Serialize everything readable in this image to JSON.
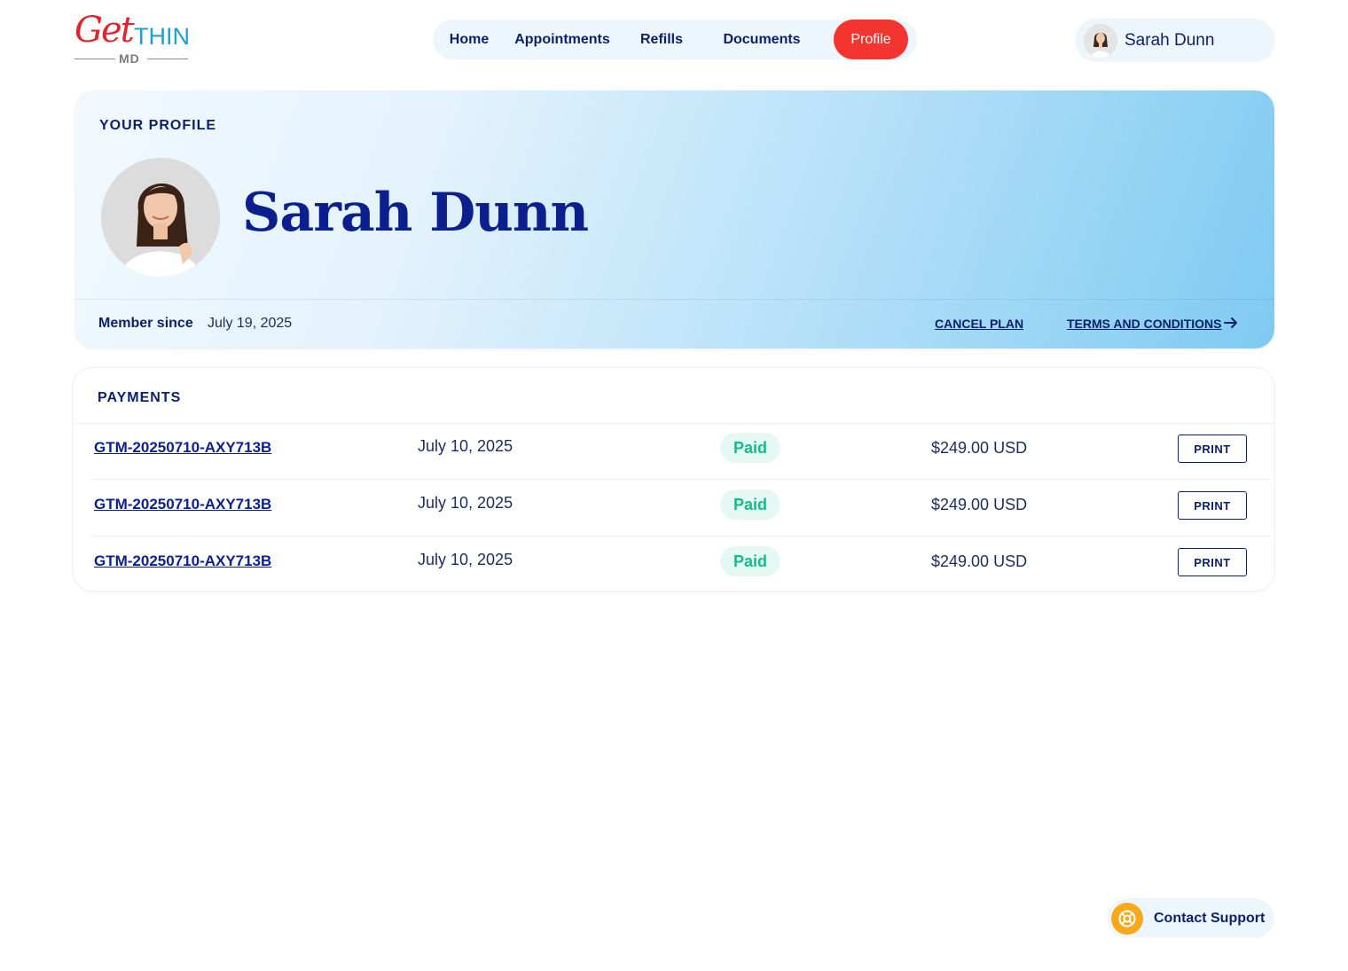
{
  "brand": {
    "logo_get": "Get",
    "logo_thin": "THIN",
    "logo_md": "MD",
    "red": "#e0242b",
    "teal": "#1ea3c8"
  },
  "nav": {
    "items": [
      {
        "label": "Home",
        "active": false
      },
      {
        "label": "Appointments",
        "active": false
      },
      {
        "label": "Refills",
        "active": false
      },
      {
        "label": "Documents",
        "active": false
      },
      {
        "label": "Profile",
        "active": true
      }
    ],
    "active_color": "#f4352f"
  },
  "user": {
    "name": "Sarah Dunn"
  },
  "profile": {
    "section_title": "YOUR PROFILE",
    "name": "Sarah Dunn",
    "member_since_label": "Member since",
    "member_since_date": "July 19, 2025",
    "cancel_plan_label": "CANCEL PLAN",
    "terms_label": "TERMS AND CONDITIONS"
  },
  "payments": {
    "section_title": "PAYMENTS",
    "rows": [
      {
        "id": "GTM-20250710-AXY713B",
        "date": "July 10, 2025",
        "status": "Paid",
        "amount": "$249.00 USD",
        "action": "PRINT"
      },
      {
        "id": "GTM-20250710-AXY713B",
        "date": "July 10, 2025",
        "status": "Paid",
        "amount": "$249.00 USD",
        "action": "PRINT"
      },
      {
        "id": "GTM-20250710-AXY713B",
        "date": "July 10, 2025",
        "status": "Paid",
        "amount": "$249.00 USD",
        "action": "PRINT"
      }
    ],
    "status_color": "#0fbf8a"
  },
  "support": {
    "label": "Contact Support",
    "icon": "lifebuoy-icon",
    "icon_color": "#f7a81b"
  }
}
